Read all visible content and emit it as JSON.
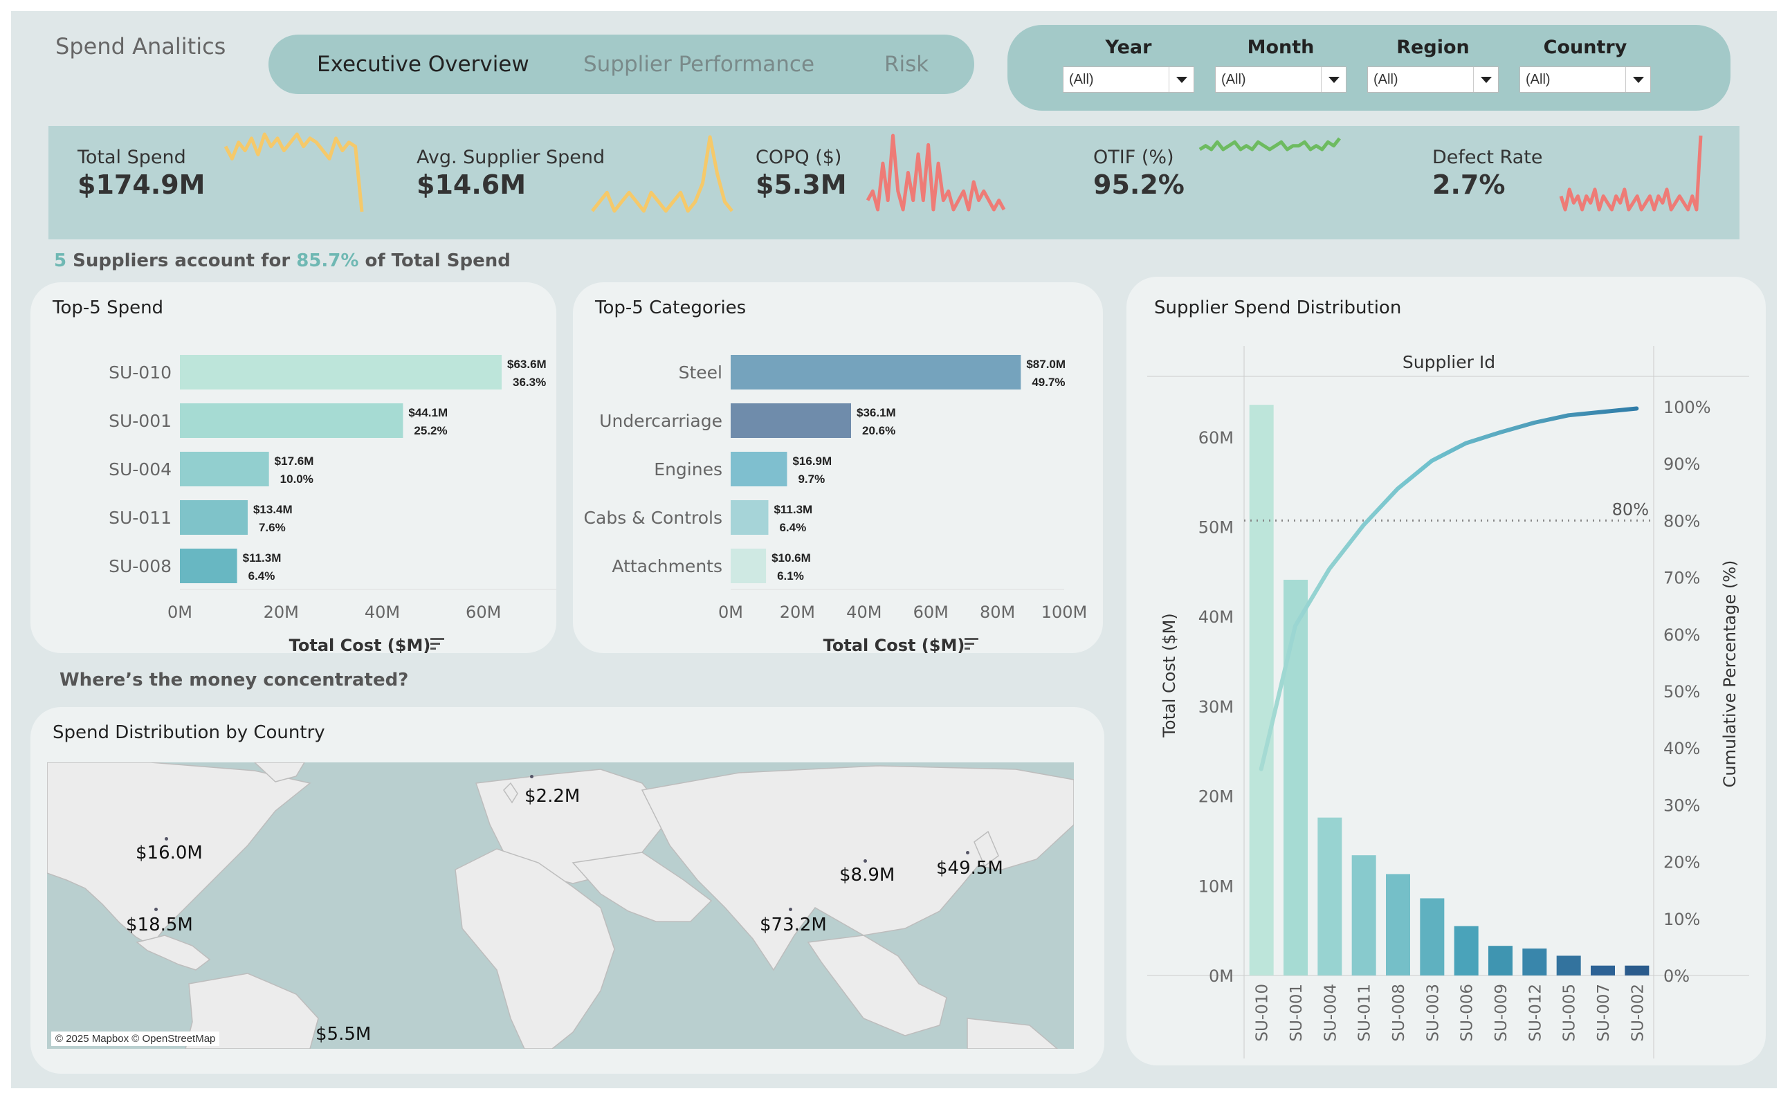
{
  "app": {
    "title": "Spend Analitics"
  },
  "tabs": [
    {
      "label": "Executive Overview",
      "active": true
    },
    {
      "label": "Supplier Performance",
      "active": false
    },
    {
      "label": "Risk",
      "active": false
    }
  ],
  "filters": [
    {
      "label": "Year",
      "value": "(All)"
    },
    {
      "label": "Month",
      "value": "(All)"
    },
    {
      "label": "Region",
      "value": "(All)"
    },
    {
      "label": "Country",
      "value": "(All)"
    }
  ],
  "kpis": [
    {
      "title": "Total Spend",
      "value": "$174.9M",
      "spark_color": "#f5c96a",
      "sparkline": [
        6,
        3,
        7,
        5,
        8,
        4,
        9,
        6,
        8,
        5,
        7,
        9,
        6,
        8,
        7,
        5,
        3,
        8,
        5,
        7,
        6,
        -10
      ]
    },
    {
      "title": "Avg. Supplier Spend",
      "value": "$14.6M",
      "spark_color": "#f5c96a",
      "sparkline": [
        1,
        2,
        3,
        1,
        2,
        3,
        2,
        1,
        3,
        2,
        1,
        2,
        3,
        1,
        2,
        4,
        9,
        5,
        2,
        1
      ]
    },
    {
      "title": "COPQ ($)",
      "value": "$5.3M",
      "spark_color": "#ee7b76",
      "sparkline": [
        2,
        3,
        1,
        6,
        2,
        9,
        3,
        1,
        5,
        2,
        7,
        2,
        8,
        1,
        6,
        2,
        3,
        1,
        2,
        3,
        1,
        4,
        2,
        3,
        2,
        1,
        2,
        1
      ]
    },
    {
      "title": "OTIF (%)",
      "value": "95.2%",
      "spark_color": "#6dbb60",
      "sparkline": [
        5,
        6,
        5,
        7,
        5,
        6,
        7,
        5,
        6,
        5,
        7,
        6,
        5,
        6,
        7,
        5,
        6,
        6,
        7,
        5,
        6,
        5,
        7,
        6,
        8
      ]
    },
    {
      "title": "Defect Rate",
      "value": "2.7%",
      "spark_color": "#ee7b76",
      "sparkline": [
        3,
        1,
        4,
        2,
        3,
        1,
        3,
        2,
        4,
        1,
        3,
        2,
        1,
        3,
        2,
        4,
        1,
        2,
        3,
        1,
        2,
        3,
        1,
        3,
        2,
        4,
        1,
        2,
        3,
        2,
        1,
        3,
        1,
        12
      ]
    }
  ],
  "headline": {
    "count": "5",
    "mid": " Suppliers account for ",
    "pct": "85.7%",
    "tail": " of Total Spend"
  },
  "top5_spend": {
    "title": "Top-5 Spend",
    "xlabel": "Total Cost ($M)",
    "ticks": [
      "0M",
      "20M",
      "40M",
      "60M"
    ],
    "rows": [
      {
        "label": "SU-010",
        "value": 63.6,
        "value_label": "$63.6M",
        "pct": "36.3%",
        "color": "#bde5da"
      },
      {
        "label": "SU-001",
        "value": 44.1,
        "value_label": "$44.1M",
        "pct": "25.2%",
        "color": "#a6dbd3"
      },
      {
        "label": "SU-004",
        "value": 17.6,
        "value_label": "$17.6M",
        "pct": "10.0%",
        "color": "#92cfcf"
      },
      {
        "label": "SU-011",
        "value": 13.4,
        "value_label": "$13.4M",
        "pct": "7.6%",
        "color": "#7fc3c9"
      },
      {
        "label": "SU-008",
        "value": 11.3,
        "value_label": "$11.3M",
        "pct": "6.4%",
        "color": "#68b7c2"
      }
    ]
  },
  "top5_categories": {
    "title": "Top-5 Categories",
    "xlabel": "Total Cost ($M)",
    "ticks": [
      "0M",
      "20M",
      "40M",
      "60M",
      "80M",
      "100M"
    ],
    "rows": [
      {
        "label": "Steel",
        "value": 87.0,
        "value_label": "$87.0M",
        "pct": "49.7%",
        "color": "#75a3bd"
      },
      {
        "label": "Undercarriage",
        "value": 36.1,
        "value_label": "$36.1M",
        "pct": "20.6%",
        "color": "#6f8cab"
      },
      {
        "label": "Engines",
        "value": 16.9,
        "value_label": "$16.9M",
        "pct": "9.7%",
        "color": "#7fbfcf"
      },
      {
        "label": "Cabs & Controls",
        "value": 11.3,
        "value_label": "$11.3M",
        "pct": "6.4%",
        "color": "#a6d4d8"
      },
      {
        "label": "Attachments",
        "value": 10.6,
        "value_label": "$10.6M",
        "pct": "6.1%",
        "color": "#cfe9e3"
      }
    ]
  },
  "subhead": "Where’s the money concentrated?",
  "map": {
    "title": "Spend Distribution by Country",
    "attribution": "© 2025 Mapbox © OpenStreetMap",
    "labels": [
      "$2.2M",
      "$16.0M",
      "$18.5M",
      "$8.9M",
      "$49.5M",
      "$73.2M",
      "$5.5M"
    ]
  },
  "chart_data": {
    "type": "bar",
    "title": "Supplier Spend Distribution",
    "header": "Supplier Id",
    "ylabel": "Total Cost ($M)",
    "y2label": "Cumulative Percentage (%)",
    "ylim": [
      0,
      65
    ],
    "y2lim": [
      0,
      100
    ],
    "yticks": [
      "0M",
      "10M",
      "20M",
      "30M",
      "40M",
      "50M",
      "60M"
    ],
    "y2ticks": [
      "0%",
      "10%",
      "20%",
      "30%",
      "40%",
      "50%",
      "60%",
      "70%",
      "80%",
      "90%",
      "100%"
    ],
    "reference_line": {
      "value": 80,
      "label": "80%"
    },
    "categories": [
      "SU-010",
      "SU-001",
      "SU-004",
      "SU-011",
      "SU-008",
      "SU-003",
      "SU-006",
      "SU-009",
      "SU-012",
      "SU-005",
      "SU-007",
      "SU-002"
    ],
    "series": [
      {
        "values": [
          63.6,
          44.1,
          17.6,
          13.4,
          11.3,
          8.6,
          5.5,
          3.3,
          3.0,
          2.2,
          1.1,
          1.1
        ],
        "colors": [
          "#bde5da",
          "#a6dbd3",
          "#98d3d1",
          "#88cacd",
          "#75bfc8",
          "#5fb1c0",
          "#4aa3ba",
          "#3f95b1",
          "#3986ab",
          "#33739e",
          "#2c6295",
          "#2a5b8c"
        ]
      },
      {
        "values": [
          36.3,
          61.5,
          71.5,
          79.2,
          85.6,
          90.5,
          93.6,
          95.5,
          97.2,
          98.5,
          99.1,
          99.7
        ]
      }
    ]
  }
}
